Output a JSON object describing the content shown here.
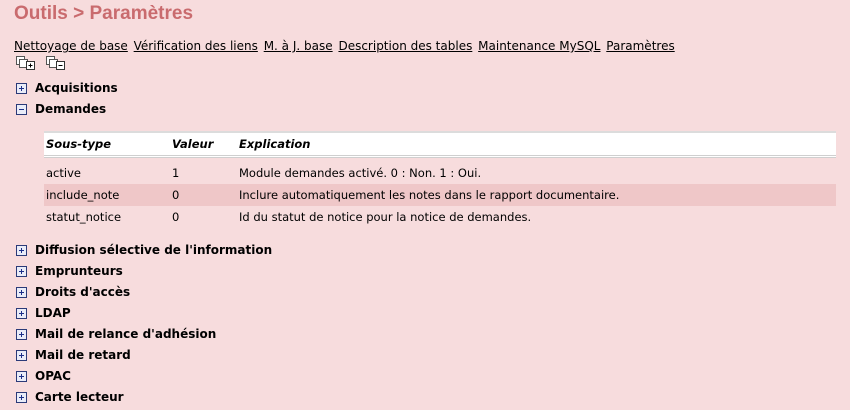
{
  "page": {
    "title": "Outils > Paramètres"
  },
  "tabs": [
    "Nettoyage de base",
    "Vérification des liens",
    "M. à J. base",
    "Description des tables",
    "Maintenance MySQL",
    "Paramètres"
  ],
  "tools": {
    "expand_all_icon": "expand-all-icon",
    "collapse_all_icon": "collapse-all-icon"
  },
  "sections": [
    {
      "label": "Acquisitions",
      "state": "collapsed"
    },
    {
      "label": "Demandes",
      "state": "expanded"
    },
    {
      "label": "Diffusion sélective de l'information",
      "state": "collapsed"
    },
    {
      "label": "Emprunteurs",
      "state": "collapsed"
    },
    {
      "label": "Droits d'accès",
      "state": "collapsed"
    },
    {
      "label": "LDAP",
      "state": "collapsed"
    },
    {
      "label": "Mail de relance d'adhésion",
      "state": "collapsed"
    },
    {
      "label": "Mail de retard",
      "state": "collapsed"
    },
    {
      "label": "OPAC",
      "state": "collapsed"
    },
    {
      "label": "Carte lecteur",
      "state": "collapsed"
    }
  ],
  "table": {
    "headers": [
      "Sous-type",
      "Valeur",
      "Explication"
    ],
    "rows": [
      [
        "active",
        "1",
        "Module demandes activé. 0 : Non. 1 : Oui."
      ],
      [
        "include_note",
        "0",
        "Inclure automatiquement les notes dans le rapport documentaire."
      ],
      [
        "statut_notice",
        "0",
        "Id du statut de notice pour la notice de demandes."
      ]
    ]
  },
  "colors": {
    "background": "#f7dcdd",
    "title": "#c96b6e",
    "row_highlight": "#efc7c8"
  }
}
